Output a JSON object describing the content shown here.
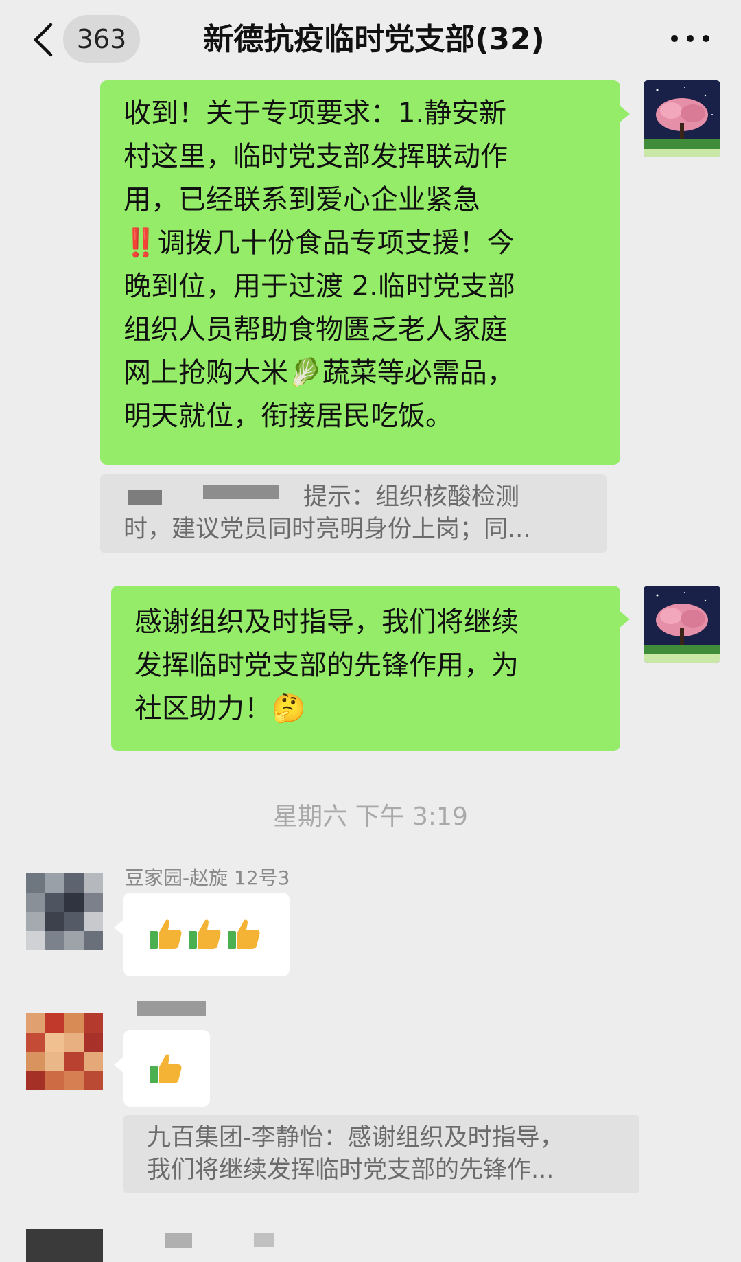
{
  "header": {
    "unread_count": "363",
    "title": "新德抗疫临时党支部(32)"
  },
  "messages": {
    "msg1_lines": [
      "收到！关于专项要求：1.静安新",
      "村这里，临时党支部发挥联动作",
      "用，已经联系到爱心企业紧急",
      "‼️调拨几十份食品专项支援！今",
      "晚到位，用于过渡 2.临时党支部",
      "组织人员帮助食物匮乏老人家庭",
      "网上抢购大米🥬蔬菜等必需品，",
      "明天就位，衔接居民吃饭。"
    ],
    "quote1_lines": [
      "提示：组织核酸检测",
      "时，建议党员同时亮明身份上岗；同..."
    ],
    "msg2_lines": [
      "感谢组织及时指导，我们将继续",
      "发挥临时党支部的先锋作用，为",
      "社区助力！🤔"
    ],
    "timestamp": "星期六 下午 3:19",
    "member1_nickname": "豆家园-赵旋 12号3",
    "quote2_lines": [
      "九百集团-李静怡：感谢组织及时指导，",
      "我们将继续发挥临时党支部的先锋作..."
    ]
  },
  "colors": {
    "background": "#ededed",
    "self_bubble": "#95ec69",
    "other_bubble": "#ffffff",
    "quote_bg": "#e1e1e1"
  },
  "icons": [
    "back-arrow-icon",
    "more-dots-icon",
    "thumbs-up-icon"
  ]
}
